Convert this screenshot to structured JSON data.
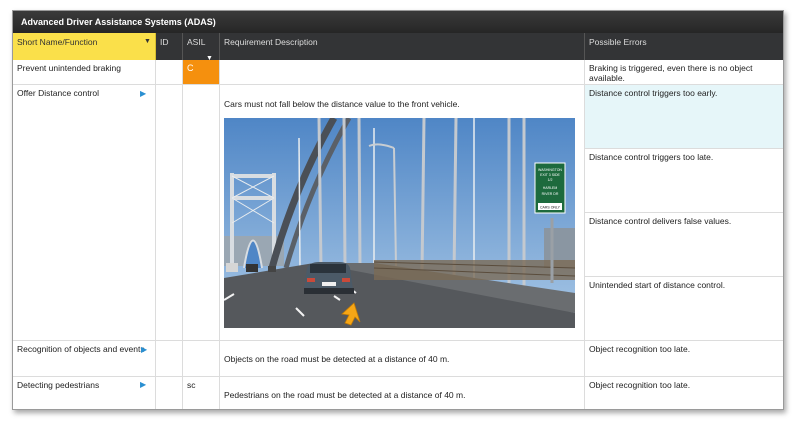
{
  "window": {
    "title": "Advanced Driver Assistance Systems (ADAS)"
  },
  "columns": {
    "short_name": "Short Name/Function",
    "id": "ID",
    "asil": "ASIL",
    "requirement": "Requirement Description",
    "errors": "Possible Errors"
  },
  "rows": [
    {
      "name": "Prevent unintended braking",
      "id": "",
      "asil": "C",
      "requirement": "",
      "errors": [
        "Braking is triggered, even there is no object available."
      ]
    },
    {
      "name": "Offer Distance control",
      "id": "",
      "asil": "",
      "requirement": "Cars must not fall below the distance value to the front vehicle.",
      "errors": [
        "Distance control triggers too early.",
        "Distance control triggers too late.",
        "Distance control delivers false values.",
        "Unintended start of distance control."
      ]
    },
    {
      "name": "Recognition of objects and events",
      "id": "",
      "asil": "",
      "requirement": "Objects on the road must be detected at a distance of 40 m.",
      "errors": [
        "Object recognition too late."
      ]
    },
    {
      "name": "Detecting pedestrians",
      "id": "",
      "asil": "sc",
      "requirement": "Pedestrians on the road must be detected at a distance of 40 m.",
      "errors": [
        "Object recognition too late."
      ]
    }
  ],
  "photo": {
    "sign_lines": [
      "WASHINGTON",
      "EXIT 3 SIDE",
      "1/2",
      "HARLEM",
      "RIVER DR",
      "CARS ONLY"
    ]
  },
  "colors": {
    "selected_header": "#fae04a",
    "asil_c": "#f5900e",
    "highlight": "#e6f6f9",
    "row_arrow": "#2a8fd1"
  }
}
